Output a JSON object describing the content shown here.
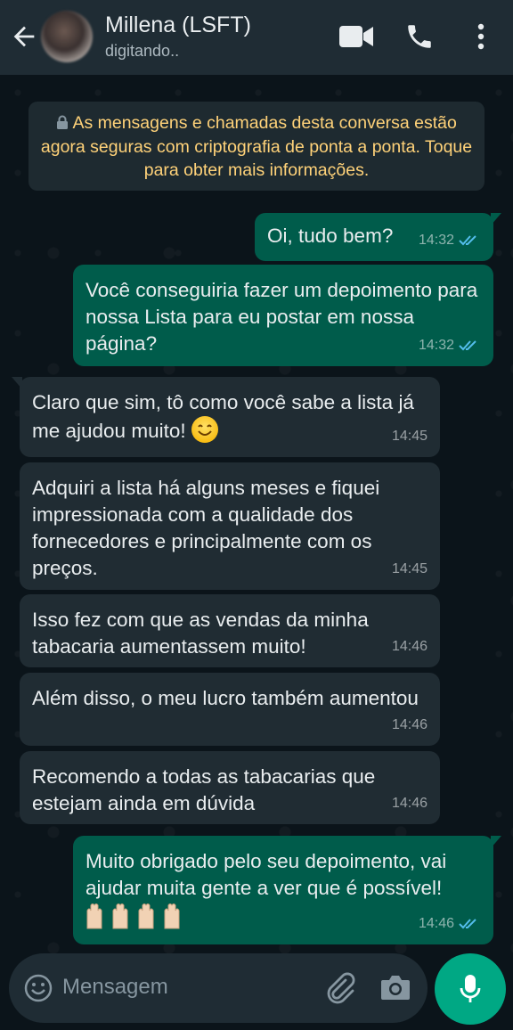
{
  "header": {
    "contact_name": "Millena (LSFT)",
    "status": "digitando..",
    "icons": [
      "back-arrow-icon",
      "video-call-icon",
      "phone-icon",
      "more-vert-icon"
    ]
  },
  "encryption_notice": "As mensagens e chamadas desta conversa estão agora seguras com criptografia de ponta a ponta. Toque para obter mais informações.",
  "messages": [
    {
      "direction": "out",
      "text": "Oi, tudo bem?",
      "time": "14:32",
      "status": "read"
    },
    {
      "direction": "out",
      "text": "Você conseguiria fazer um depoimento para nossa Lista para eu postar em nossa página?",
      "time": "14:32",
      "status": "read"
    },
    {
      "direction": "in",
      "text": "Claro que sim, tô como você sabe a lista já me ajudou muito!",
      "emoji": "smiling-face",
      "time": "14:45"
    },
    {
      "direction": "in",
      "text": "Adquiri a lista há alguns meses e fiquei impressionada com a qualidade dos fornecedores e principalmente com os preços.",
      "time": "14:45"
    },
    {
      "direction": "in",
      "text": "Isso fez com que as vendas da minha tabacaria aumentassem muito!",
      "time": "14:46"
    },
    {
      "direction": "in",
      "text": "Além disso, o meu lucro também aumentou",
      "time": "14:46"
    },
    {
      "direction": "in",
      "text": "Recomendo a todas as tabacarias que estejam ainda em dúvida",
      "time": "14:46"
    },
    {
      "direction": "out",
      "text": "Muito obrigado pelo seu depoimento, vai ajudar muita gente a ver que é possível!",
      "emoji": "raising-hands x4",
      "time": "14:46",
      "status": "read"
    }
  ],
  "input": {
    "placeholder": "Mensagem",
    "icons": [
      "emoji-icon",
      "attach-icon",
      "camera-icon",
      "mic-icon"
    ]
  },
  "colors": {
    "header_bg": "#1f2c34",
    "outgoing_bubble": "#005c4b",
    "incoming_bubble": "#202c33",
    "notice_text": "#ffd279",
    "read_tick": "#53bdeb",
    "accent": "#00a884"
  }
}
